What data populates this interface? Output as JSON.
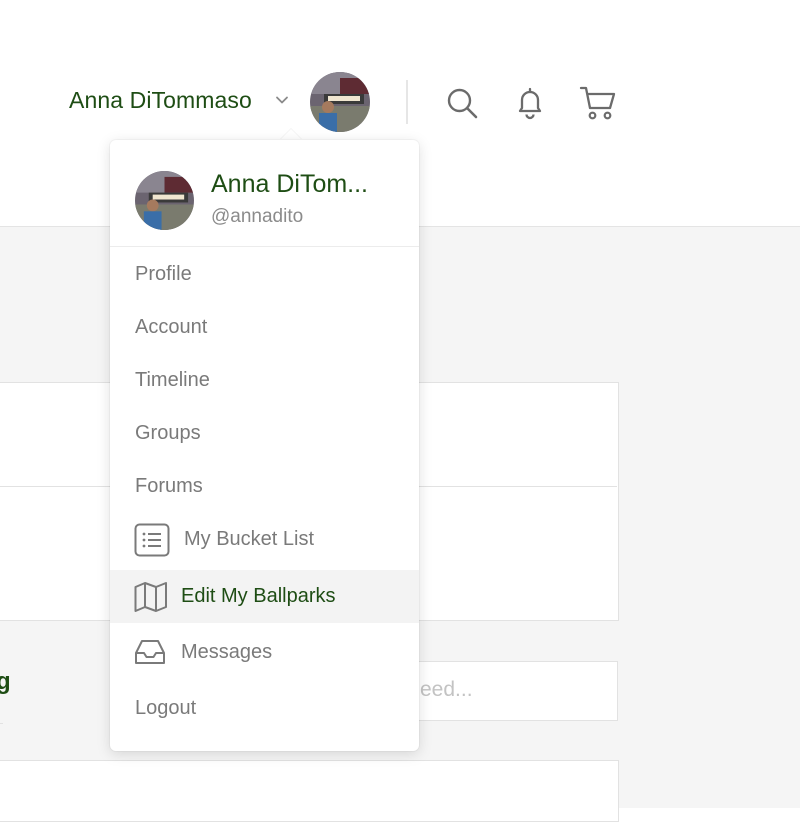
{
  "header": {
    "user_name": "Anna DiTommaso"
  },
  "icons": {
    "caret": "chevron-down-icon",
    "search": "search-icon",
    "notifications": "bell-icon",
    "cart": "cart-icon"
  },
  "dropdown": {
    "name": "Anna DiTom...",
    "handle": "@annadito",
    "items": [
      {
        "label": "Profile"
      },
      {
        "label": "Account"
      },
      {
        "label": "Timeline"
      },
      {
        "label": "Groups"
      },
      {
        "label": "Forums"
      },
      {
        "label": "My Bucket List",
        "icon": "list-icon"
      },
      {
        "label": "Edit My Ballparks",
        "icon": "map-icon",
        "active": true
      },
      {
        "label": "Messages",
        "icon": "inbox-icon"
      },
      {
        "label": "Logout"
      }
    ]
  },
  "background": {
    "partial_letter": "g",
    "feed_placeholder_fragment": "eed..."
  },
  "colors": {
    "brand_green": "#1e4d14",
    "muted_text": "#7a7a7a",
    "page_bg": "#f5f5f5"
  }
}
